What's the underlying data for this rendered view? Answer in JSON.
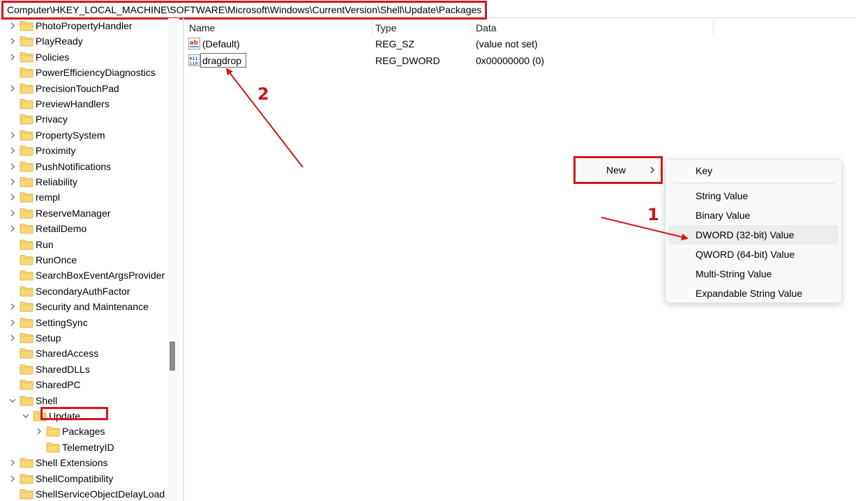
{
  "address_bar": {
    "path": "Computer\\HKEY_LOCAL_MACHINE\\SOFTWARE\\Microsoft\\Windows\\CurrentVersion\\Shell\\Update\\Packages"
  },
  "tree": {
    "items": [
      {
        "label": "PhotoPropertyHandler",
        "expander": "right"
      },
      {
        "label": "PlayReady",
        "expander": "right"
      },
      {
        "label": "Policies",
        "expander": "right"
      },
      {
        "label": "PowerEfficiencyDiagnostics",
        "expander": "none"
      },
      {
        "label": "PrecisionTouchPad",
        "expander": "right"
      },
      {
        "label": "PreviewHandlers",
        "expander": "none"
      },
      {
        "label": "Privacy",
        "expander": "none"
      },
      {
        "label": "PropertySystem",
        "expander": "right"
      },
      {
        "label": "Proximity",
        "expander": "right"
      },
      {
        "label": "PushNotifications",
        "expander": "right"
      },
      {
        "label": "Reliability",
        "expander": "right"
      },
      {
        "label": "rempl",
        "expander": "right"
      },
      {
        "label": "ReserveManager",
        "expander": "right"
      },
      {
        "label": "RetailDemo",
        "expander": "right"
      },
      {
        "label": "Run",
        "expander": "none"
      },
      {
        "label": "RunOnce",
        "expander": "none"
      },
      {
        "label": "SearchBoxEventArgsProvider",
        "expander": "none"
      },
      {
        "label": "SecondaryAuthFactor",
        "expander": "none"
      },
      {
        "label": "Security and Maintenance",
        "expander": "right"
      },
      {
        "label": "SettingSync",
        "expander": "right"
      },
      {
        "label": "Setup",
        "expander": "right"
      },
      {
        "label": "SharedAccess",
        "expander": "none"
      },
      {
        "label": "SharedDLLs",
        "expander": "none"
      },
      {
        "label": "SharedPC",
        "expander": "none"
      },
      {
        "label": "Shell",
        "expander": "down"
      },
      {
        "label": "Update",
        "expander": "down"
      },
      {
        "label": "Packages",
        "expander": "right"
      },
      {
        "label": "TelemetryID",
        "expander": "none"
      },
      {
        "label": "Shell Extensions",
        "expander": "right"
      },
      {
        "label": "ShellCompatibility",
        "expander": "right"
      },
      {
        "label": "ShellServiceObjectDelayLoad",
        "expander": "none"
      }
    ],
    "selected": "Packages"
  },
  "list": {
    "headers": {
      "name": "Name",
      "type": "Type",
      "data": "Data"
    },
    "rows": [
      {
        "icon": "string-value-icon",
        "name": "(Default)",
        "type": "REG_SZ",
        "data": "(value not set)"
      },
      {
        "icon": "binary-value-icon",
        "name": "dragdrop",
        "type": "REG_DWORD",
        "data": "0x00000000 (0)"
      }
    ]
  },
  "context_menu": {
    "new_label": "New",
    "submenu": [
      {
        "label": "Key",
        "highlighted": false
      },
      {
        "label": "String Value",
        "highlighted": false
      },
      {
        "label": "Binary Value",
        "highlighted": false
      },
      {
        "label": "DWORD (32-bit) Value",
        "highlighted": true
      },
      {
        "label": "QWORD (64-bit) Value",
        "highlighted": false
      },
      {
        "label": "Multi-String Value",
        "highlighted": false
      },
      {
        "label": "Expandable String Value",
        "highlighted": false
      }
    ]
  },
  "annotations": {
    "step1": "1",
    "step2": "2"
  },
  "colors": {
    "annotation_red": "#d4161c",
    "folder_yellow": "#f8d775",
    "highlight": "#ececec"
  }
}
